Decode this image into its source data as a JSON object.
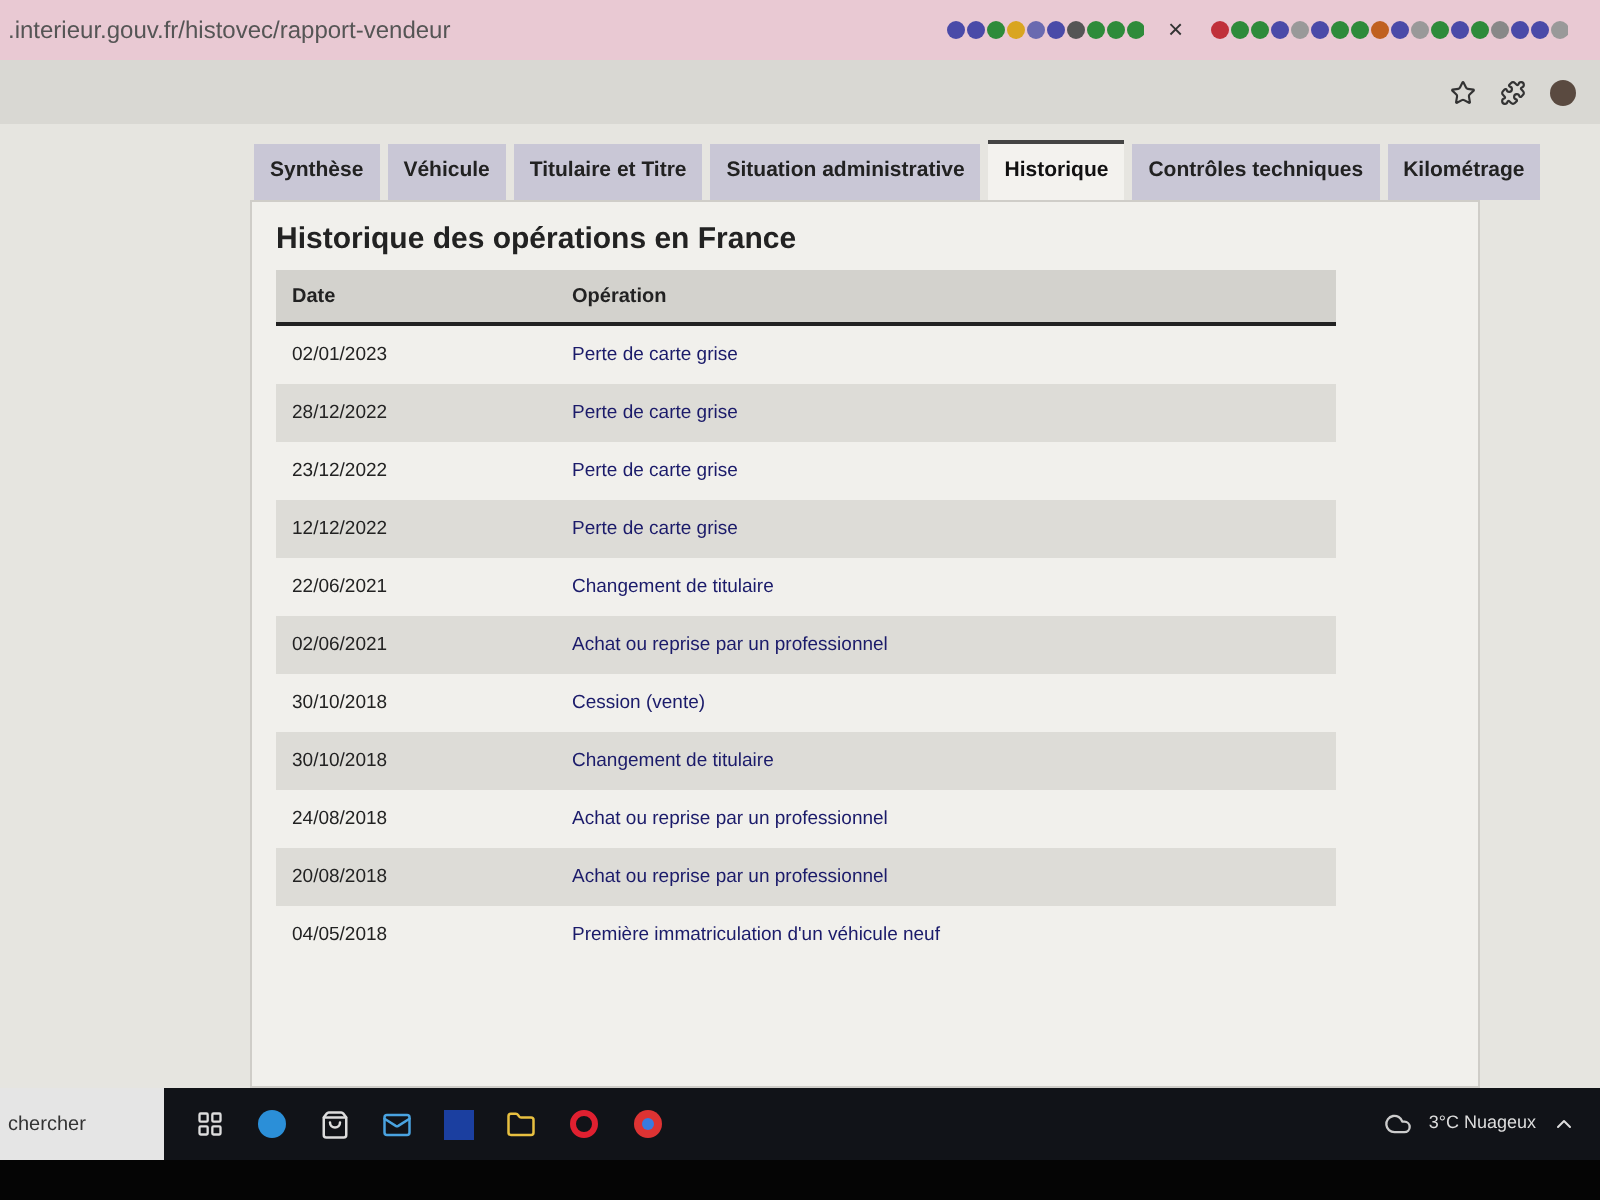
{
  "browser": {
    "url": ".interieur.gouv.fr/histovec/rapport-vendeur",
    "tab_close": "×"
  },
  "tabs": [
    {
      "label": "Synthèse",
      "selected": false
    },
    {
      "label": "Véhicule",
      "selected": false
    },
    {
      "label": "Titulaire et Titre",
      "selected": false
    },
    {
      "label": "Situation administrative",
      "selected": false
    },
    {
      "label": "Historique",
      "selected": true
    },
    {
      "label": "Contrôles techniques",
      "selected": false
    },
    {
      "label": "Kilométrage",
      "selected": false
    }
  ],
  "section": {
    "title": "Historique des opérations en France"
  },
  "table": {
    "columns": [
      "Date",
      "Opération"
    ],
    "rows": [
      [
        "02/01/2023",
        "Perte de carte grise"
      ],
      [
        "28/12/2022",
        "Perte de carte grise"
      ],
      [
        "23/12/2022",
        "Perte de carte grise"
      ],
      [
        "12/12/2022",
        "Perte de carte grise"
      ],
      [
        "22/06/2021",
        "Changement de titulaire"
      ],
      [
        "02/06/2021",
        "Achat ou reprise par un professionnel"
      ],
      [
        "30/10/2018",
        "Cession (vente)"
      ],
      [
        "30/10/2018",
        "Changement de titulaire"
      ],
      [
        "24/08/2018",
        "Achat ou reprise par un professionnel"
      ],
      [
        "20/08/2018",
        "Achat ou reprise par un professionnel"
      ],
      [
        "04/05/2018",
        "Première immatriculation d'un véhicule neuf"
      ]
    ]
  },
  "taskbar": {
    "search": "chercher",
    "weather": "3°C Nuageux"
  }
}
